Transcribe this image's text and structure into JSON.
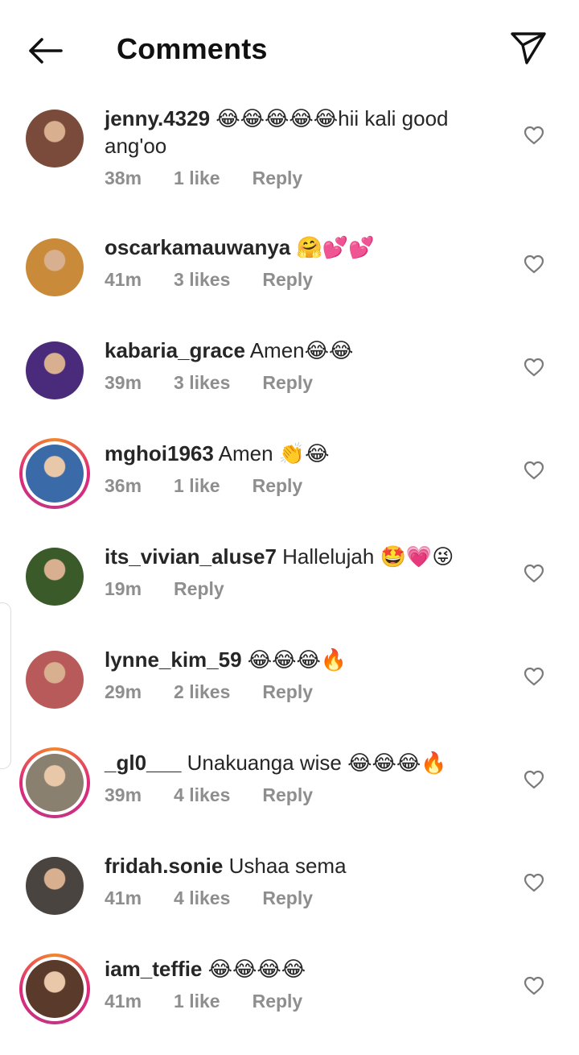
{
  "header": {
    "title": "Comments"
  },
  "comments": [
    {
      "username": "jenny.4329",
      "text": "😂😂😂😂😂hii kali good ang'oo",
      "time": "38m",
      "likes": "1 like",
      "reply": "Reply",
      "avatar_color": "#7a4a3a",
      "story": false
    },
    {
      "username": "oscarkamauwanya",
      "text": "🤗💕💕",
      "time": "41m",
      "likes": "3 likes",
      "reply": "Reply",
      "avatar_color": "#c98a3a",
      "story": false
    },
    {
      "username": "kabaria_grace",
      "text": "Amen😂😂",
      "time": "39m",
      "likes": "3 likes",
      "reply": "Reply",
      "avatar_color": "#4a2a7a",
      "story": false
    },
    {
      "username": "mghoi1963",
      "text": "Amen 👏😂",
      "time": "36m",
      "likes": "1 like",
      "reply": "Reply",
      "avatar_color": "#3a6aa8",
      "story": true
    },
    {
      "username": "its_vivian_aluse7",
      "text": "Hallelujah 🤩💗😜",
      "time": "19m",
      "likes": "",
      "reply": "Reply",
      "avatar_color": "#3a5a2a",
      "story": false
    },
    {
      "username": "lynne_kim_59",
      "text": "😂😂😂🔥",
      "time": "29m",
      "likes": "2 likes",
      "reply": "Reply",
      "avatar_color": "#b85a5a",
      "story": false
    },
    {
      "username": "_gl0___",
      "text": "Unakuanga wise 😂😂😂🔥",
      "time": "39m",
      "likes": "4 likes",
      "reply": "Reply",
      "avatar_color": "#8a8070",
      "story": true
    },
    {
      "username": "fridah.sonie",
      "text": "Ushaa sema",
      "time": "41m",
      "likes": "4 likes",
      "reply": "Reply",
      "avatar_color": "#4a4440",
      "story": false
    },
    {
      "username": "iam_teffie",
      "text": "😂😂😂😂",
      "time": "41m",
      "likes": "1 like",
      "reply": "Reply",
      "avatar_color": "#5a3a2a",
      "story": true
    }
  ],
  "icons": {
    "back": "arrow-left-icon",
    "share": "paper-plane-icon",
    "like": "heart-outline-icon"
  }
}
